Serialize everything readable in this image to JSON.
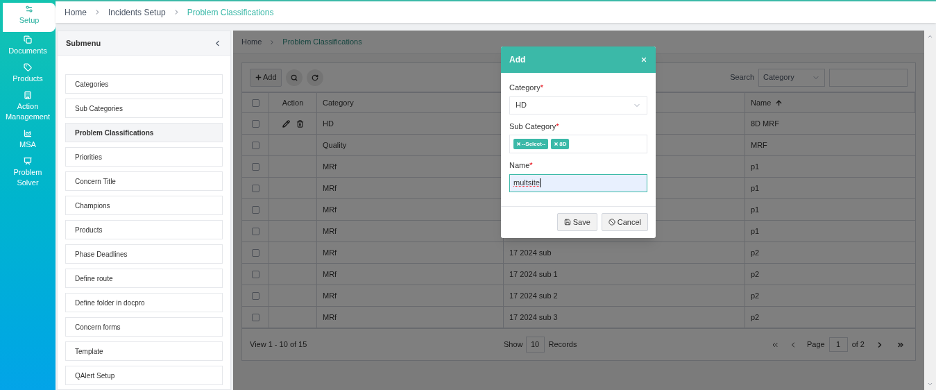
{
  "rail": [
    {
      "label": "Setup",
      "selected": true
    },
    {
      "label": "Documents",
      "selected": false
    },
    {
      "label": "Products",
      "selected": false
    },
    {
      "label": "Action Management",
      "selected": false
    },
    {
      "label": "MSA",
      "selected": false
    },
    {
      "label": "Problem Solver",
      "selected": false
    }
  ],
  "breadcrumb": [
    "Home",
    "Incidents Setup",
    "Problem Classifications"
  ],
  "submenu": {
    "title": "Submenu",
    "items": [
      {
        "label": "Categories",
        "selected": false
      },
      {
        "label": "Sub Categories",
        "selected": false
      },
      {
        "label": "Problem Classifications",
        "selected": true
      },
      {
        "label": "Priorities",
        "selected": false
      },
      {
        "label": "Concern Title",
        "selected": false
      },
      {
        "label": "Champions",
        "selected": false
      },
      {
        "label": "Products",
        "selected": false
      },
      {
        "label": "Phase Deadlines",
        "selected": false
      },
      {
        "label": "Define route",
        "selected": false
      },
      {
        "label": "Define folder in docpro",
        "selected": false
      },
      {
        "label": "Concern forms",
        "selected": false
      },
      {
        "label": "Template",
        "selected": false
      },
      {
        "label": "QAlert Setup",
        "selected": false
      }
    ]
  },
  "content": {
    "breadcrumb": [
      "Home",
      "Problem Classifications"
    ],
    "toolbar": {
      "add": "Add",
      "search_label": "Search",
      "search_field": "Category"
    },
    "table": {
      "header_checked": false,
      "columns": [
        {
          "label": "Action",
          "sorted": false
        },
        {
          "label": "Category",
          "sorted": false
        },
        {},
        {
          "label": "Name",
          "sorted": true
        }
      ],
      "rows": [
        {
          "checked": false,
          "actions": true,
          "category": "HD",
          "name": "8D MRF"
        },
        {
          "checked": false,
          "actions": false,
          "category": "Quality",
          "name": "MRF"
        },
        {
          "checked": false,
          "actions": false,
          "category": "MRf",
          "name": "p1"
        },
        {
          "checked": false,
          "actions": false,
          "category": "MRf",
          "name": "p1"
        },
        {
          "checked": false,
          "actions": false,
          "category": "MRf",
          "name": "p1"
        },
        {
          "checked": false,
          "actions": false,
          "category": "MRf",
          "name": "p1"
        },
        {
          "checked": false,
          "actions": false,
          "category": "MRf",
          "sub_category": "17 2024 sub",
          "name": "p2"
        },
        {
          "checked": false,
          "actions": false,
          "category": "MRf",
          "sub_category": "17 2024 sub 1",
          "name": "p2"
        },
        {
          "checked": false,
          "actions": false,
          "category": "MRf",
          "sub_category": "17 2024 sub 2",
          "name": "p2"
        },
        {
          "checked": false,
          "actions": false,
          "category": "MRf",
          "sub_category": "17 2024 sub 3",
          "name": "p2"
        }
      ]
    },
    "footer": {
      "summary": "View 1 - 10 of 15",
      "show": "Show",
      "page_size": "10",
      "records": "Records",
      "page": "Page",
      "page_number": "1",
      "of": "of 2"
    }
  },
  "dialog": {
    "title": "Add",
    "fields": [
      {
        "kind": "select",
        "label": "Category",
        "required_mark": "*",
        "value": "HD"
      },
      {
        "kind": "tags",
        "label": "Sub Category",
        "required_mark": "*",
        "tags": [
          "--Select--",
          "8D"
        ]
      },
      {
        "kind": "text",
        "label": "Name",
        "required_mark": "*",
        "value": "multsite",
        "focused": true
      }
    ],
    "buttons": [
      {
        "label": "Save"
      },
      {
        "label": "Cancel"
      }
    ]
  }
}
